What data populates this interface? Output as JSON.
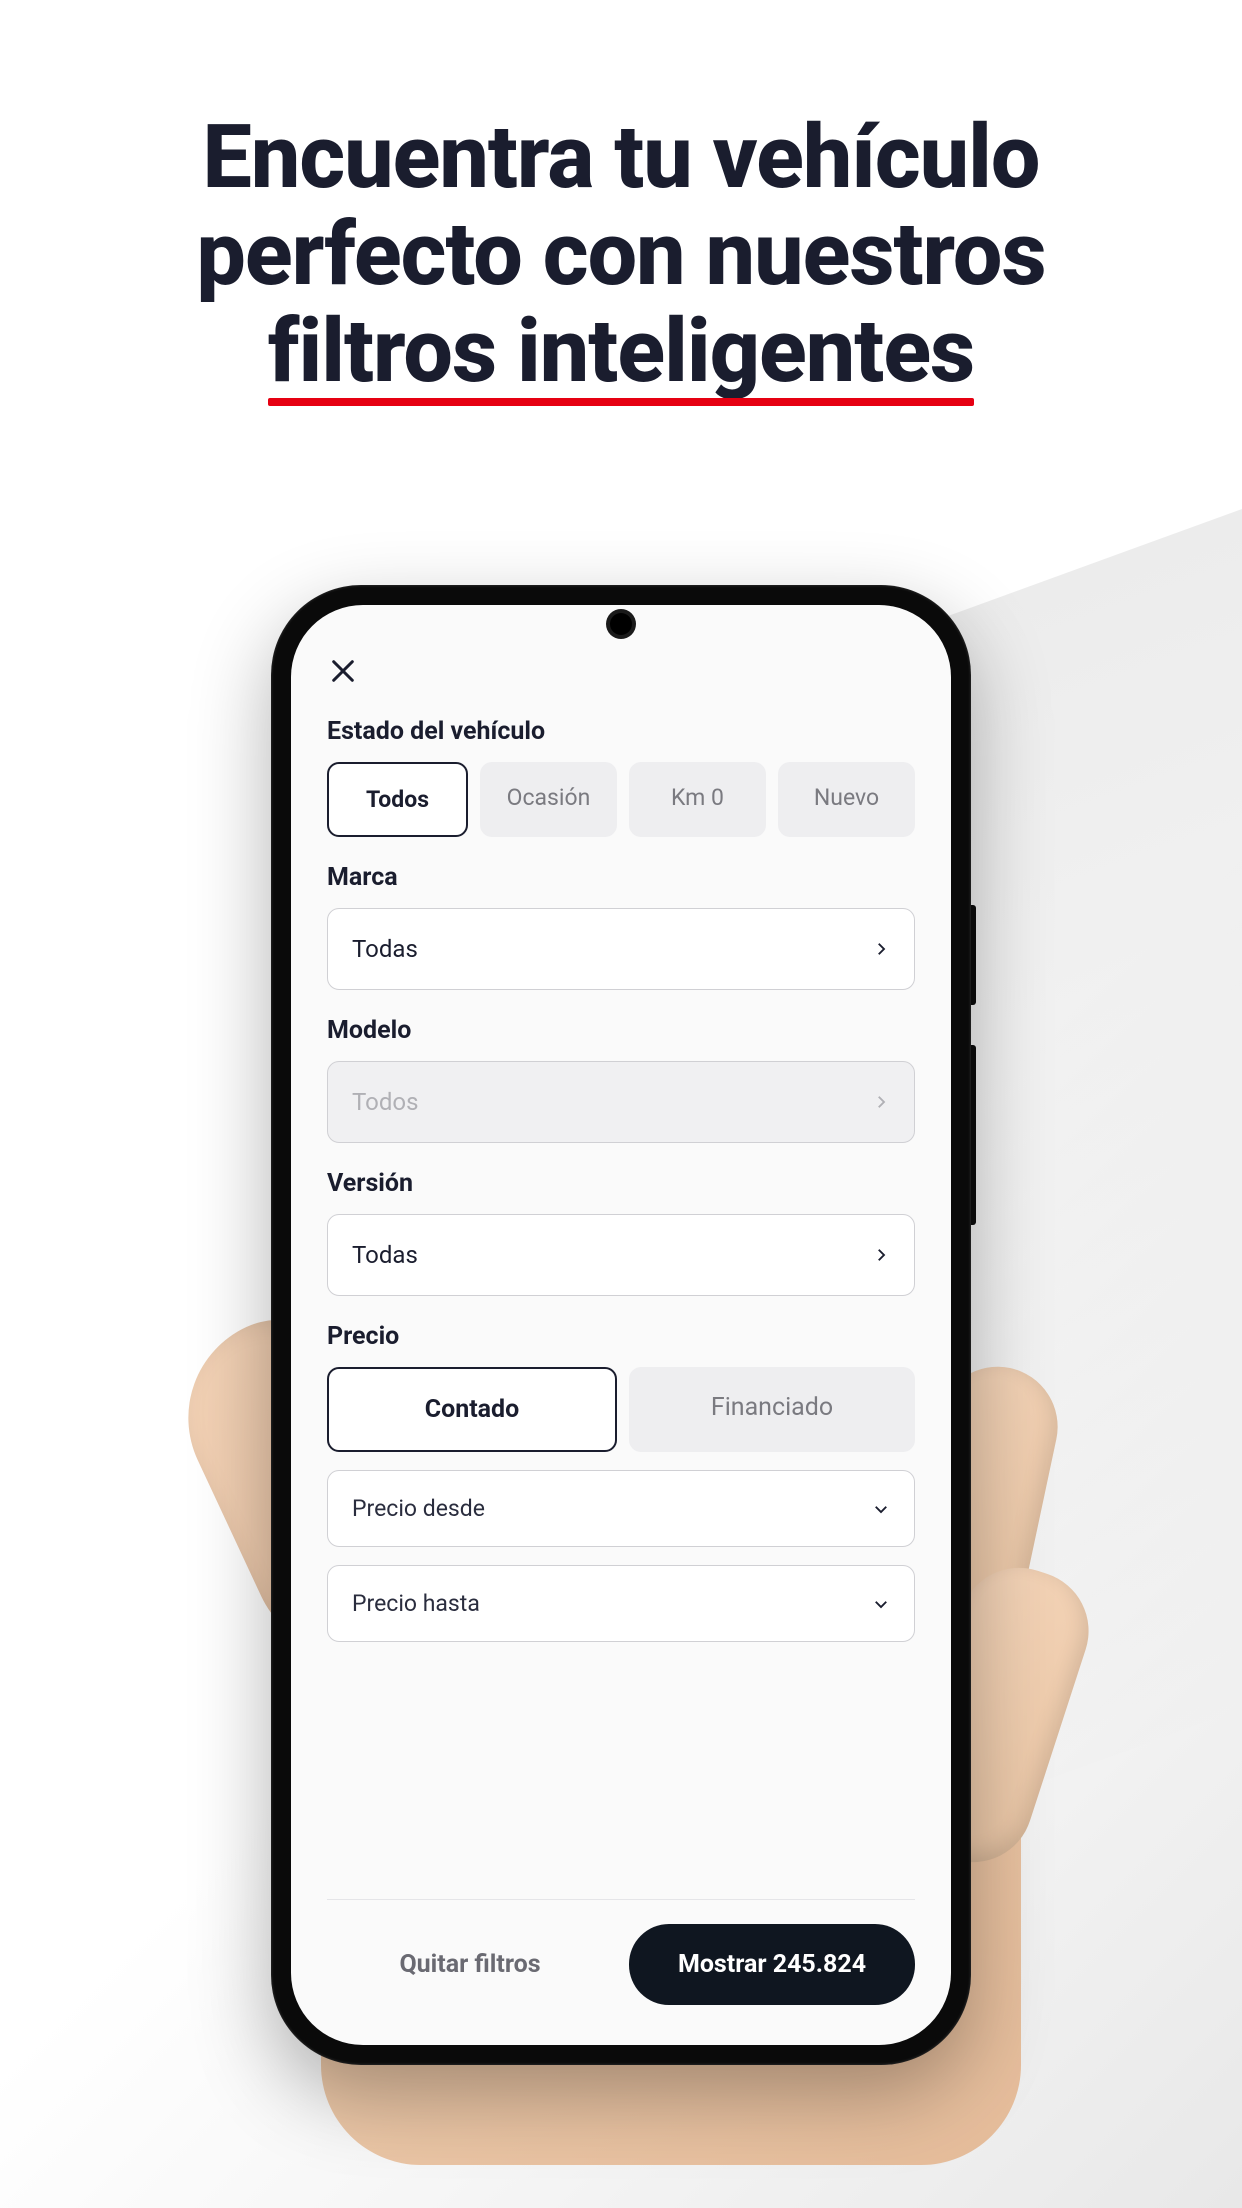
{
  "headline": {
    "line1": "Encuentra tu vehículo",
    "line2": "perfecto con nuestros",
    "line3": "filtros inteligentes"
  },
  "filters": {
    "state": {
      "label": "Estado del vehículo",
      "options": [
        "Todos",
        "Ocasión",
        "Km 0",
        "Nuevo"
      ],
      "active": 0
    },
    "brand": {
      "label": "Marca",
      "value": "Todas"
    },
    "model": {
      "label": "Modelo",
      "value": "Todos",
      "disabled": true
    },
    "version": {
      "label": "Versión",
      "value": "Todas"
    },
    "price": {
      "label": "Precio",
      "tabs": [
        "Contado",
        "Financiado"
      ],
      "active": 0,
      "from_placeholder": "Precio desde",
      "to_placeholder": "Precio hasta"
    }
  },
  "footer": {
    "clear": "Quitar filtros",
    "show_prefix": "Mostrar ",
    "count": "245.824"
  }
}
